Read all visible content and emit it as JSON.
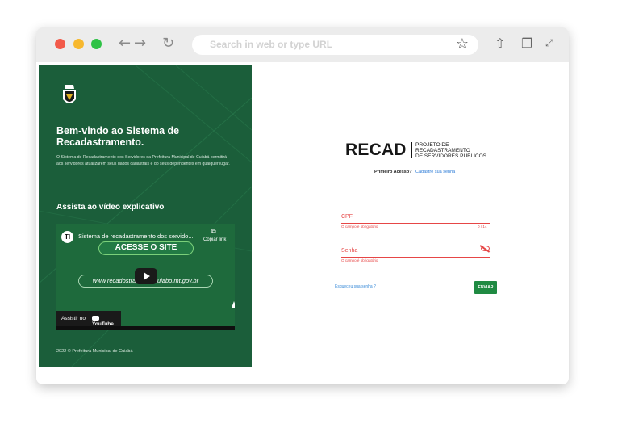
{
  "browser": {
    "address_placeholder": "Search in web or type URL"
  },
  "left_panel": {
    "welcome": "Bem-vindo ao Sistema de Recadastramento.",
    "description": "O Sistema de Recadastramento dos Servidores da Prefeitura Municipal de Cuiabá permitirá aos servidores atualizarem seus dados cadastrais e do seus dependentes em qualquer lugar.",
    "video_heading": "Assista ao vídeo explicativo",
    "video": {
      "channel_logo": "TI",
      "title": "Sistema de recadastramento dos servido...",
      "copy_label": "Copiar link",
      "banner": "ACESSE O SITE",
      "url": "www.recadostramento.cuiabo.mt.gov.br",
      "watch_label": "Assistir no",
      "youtube": "YouTube"
    },
    "copyright": "2022 © Prefeitura Municipal de Cuiabá"
  },
  "form": {
    "brand": "RECAD",
    "brand_sub_1": "PROJETO DE",
    "brand_sub_2": "RECADASTRAMENTO",
    "brand_sub_3": "DE SERVIDORES PÚBLICOS",
    "first_access": "Primeiro Acesso?",
    "register_link": "Cadastre sua senha",
    "cpf_label": "CPF",
    "cpf_error": "O campo é obrigatório",
    "cpf_counter": "0 / 14",
    "password_label": "Senha",
    "password_error": "O campo é obrigatório",
    "forgot": "Esqueceu sua senha ?",
    "send": "ENVIAR"
  },
  "colors": {
    "panel_green": "#1b5e3a",
    "error_red": "#e64646",
    "send_green": "#1f8a42",
    "link_blue": "#2a7ad6"
  },
  "icons": {
    "back": "back-arrow-icon",
    "forward": "forward-arrow-icon",
    "reload": "reload-icon",
    "bookmark": "star-icon",
    "share": "share-icon",
    "tabs": "tabs-icon",
    "fullscreen": "expand-icon",
    "password_visibility": "eye-off-icon"
  }
}
